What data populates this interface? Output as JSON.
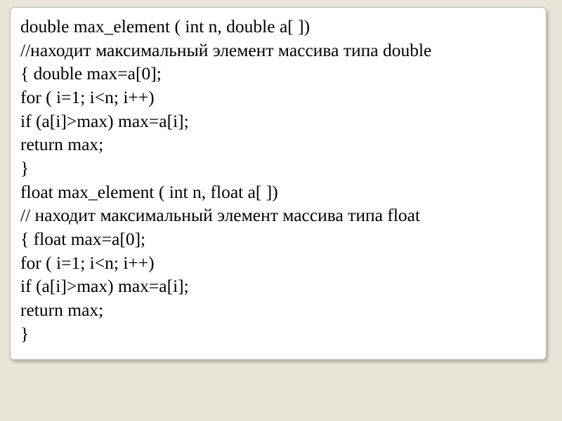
{
  "code": {
    "lines": [
      "double max_element ( int n, double a[ ])",
      "//находит максимальный элемент массива типа double",
      "{ double max=a[0];",
      "for ( i=1; i<n; i++)",
      "if (a[i]>max) max=a[i];",
      "return max;",
      "}",
      "float max_element ( int n, float a[ ])",
      "// находит максимальный элемент массива типа float",
      "{ float max=a[0];",
      "for ( i=1; i<n; i++)",
      "if (a[i]>max) max=a[i];",
      "return max;",
      "}"
    ]
  }
}
